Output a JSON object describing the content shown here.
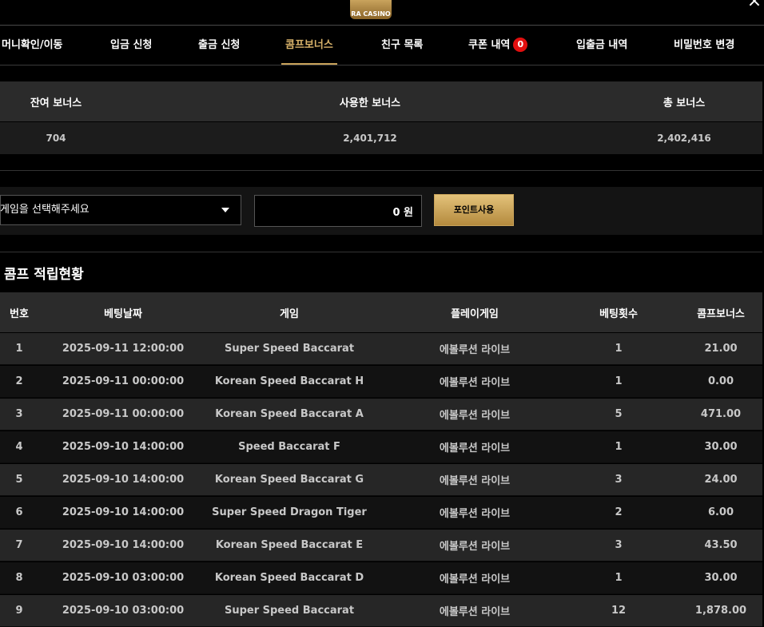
{
  "header": {
    "logo_text": "RA CASINO",
    "close_icon": "×"
  },
  "tabs": [
    {
      "label": "머니확인/이동"
    },
    {
      "label": "입금 신청"
    },
    {
      "label": "출금 신청"
    },
    {
      "label": "콤프보너스"
    },
    {
      "label": "친구 목록"
    },
    {
      "label": "쿠폰 내역",
      "badge": "0"
    },
    {
      "label": "입출금 내역"
    },
    {
      "label": "비밀번호 변경"
    }
  ],
  "active_tab": "콤프보너스",
  "summary": {
    "headers": [
      "잔여 보너스",
      "사용한 보너스",
      "총 보너스"
    ],
    "values": [
      "704",
      "2,401,712",
      "2,402,416"
    ]
  },
  "form": {
    "select_placeholder": "게임을 선택해주세요",
    "amount_value": "0 원",
    "use_button": "포인트사용"
  },
  "section_title": "콤프 적립현황",
  "table": {
    "headers": [
      "번호",
      "베팅날짜",
      "게임",
      "플레이게임",
      "베팅횟수",
      "콤프보너스"
    ],
    "rows": [
      [
        "1",
        "2025-09-11 12:00:00",
        "Super Speed Baccarat",
        "에볼루션 라이브",
        "1",
        "21.00"
      ],
      [
        "2",
        "2025-09-11 00:00:00",
        "Korean Speed Baccarat H",
        "에볼루션 라이브",
        "1",
        "0.00"
      ],
      [
        "3",
        "2025-09-11 00:00:00",
        "Korean Speed Baccarat A",
        "에볼루션 라이브",
        "5",
        "471.00"
      ],
      [
        "4",
        "2025-09-10 14:00:00",
        "Speed Baccarat F",
        "에볼루션 라이브",
        "1",
        "30.00"
      ],
      [
        "5",
        "2025-09-10 14:00:00",
        "Korean Speed Baccarat G",
        "에볼루션 라이브",
        "3",
        "24.00"
      ],
      [
        "6",
        "2025-09-10 14:00:00",
        "Super Speed Dragon Tiger",
        "에볼루션 라이브",
        "2",
        "6.00"
      ],
      [
        "7",
        "2025-09-10 14:00:00",
        "Korean Speed Baccarat E",
        "에볼루션 라이브",
        "3",
        "43.50"
      ],
      [
        "8",
        "2025-09-10 03:00:00",
        "Korean Speed Baccarat D",
        "에볼루션 라이브",
        "1",
        "30.00"
      ],
      [
        "9",
        "2025-09-10 03:00:00",
        "Super Speed Baccarat",
        "에볼루션 라이브",
        "12",
        "1,878.00"
      ]
    ]
  },
  "colors": {
    "accent": "#c9a35a",
    "badge": "#e20f0f",
    "header_bg": "#2b2b2b"
  }
}
